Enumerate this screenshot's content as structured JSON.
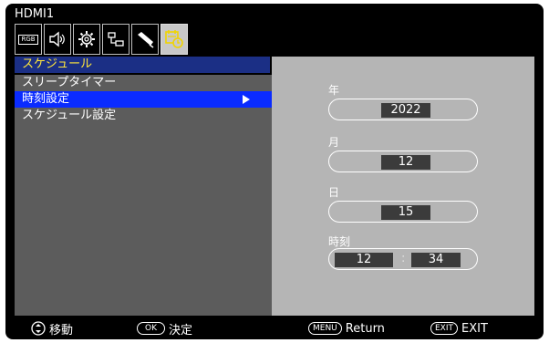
{
  "header": {
    "input": "HDMI1"
  },
  "icons": [
    {
      "name": "rgb-icon",
      "label": "RGB"
    },
    {
      "name": "speaker-icon"
    },
    {
      "name": "gear-icon"
    },
    {
      "name": "network-icon"
    },
    {
      "name": "pen-icon"
    },
    {
      "name": "calendar-clock-icon",
      "active": true
    }
  ],
  "menu": {
    "title": "スケジュール",
    "items": [
      {
        "label": "スリープタイマー"
      },
      {
        "label": "時刻設定",
        "selected": true
      },
      {
        "label": "スケジュール設定"
      }
    ]
  },
  "datetime": {
    "year_label": "年",
    "year_value": "2022",
    "month_label": "月",
    "month_value": "12",
    "day_label": "日",
    "day_value": "15",
    "time_label": "時刻",
    "hour_value": "12",
    "separator": ":",
    "minute_value": "34"
  },
  "footer": {
    "move_label": "移動",
    "ok_key": "OK",
    "ok_label": "決定",
    "menu_key": "MENU",
    "menu_label": "Return",
    "exit_key": "EXIT",
    "exit_label": "EXIT"
  },
  "colors": {
    "title_bg": "#1b2f85",
    "title_text": "#ffe63b",
    "selected_bg": "#0a2bff",
    "panel_left": "#5c5c5c",
    "panel_right": "#b5b5b5"
  }
}
